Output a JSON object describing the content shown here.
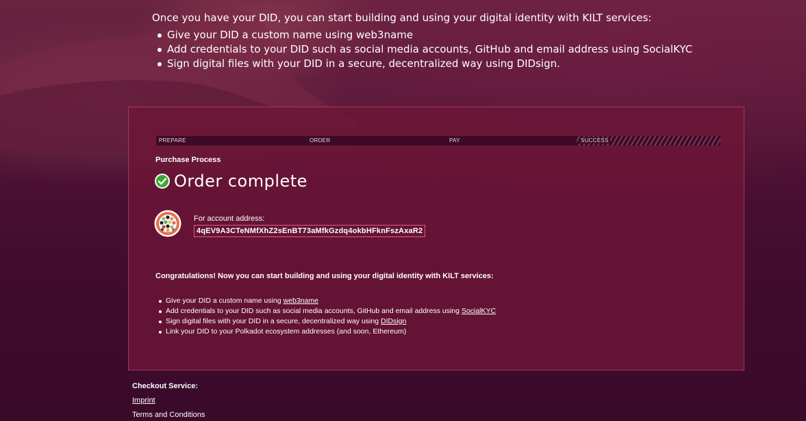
{
  "intro": {
    "heading": "Once you have your DID, you can start building and using your digital identity with KILT services:",
    "items": [
      "Give your DID a custom name using web3name",
      "Add credentials to your DID such as social media accounts, GitHub and email address using SocialKYC",
      "Sign digital files with your DID in a secure, decentralized way using DIDsign."
    ]
  },
  "steps": [
    {
      "label": "PREPARE"
    },
    {
      "label": "ORDER"
    },
    {
      "label": "PAY"
    },
    {
      "label": "SUCCESS"
    }
  ],
  "current_step": "SUCCESS",
  "purchase": {
    "title": "Purchase Process",
    "status": "Order complete",
    "account_label": "For account address:",
    "account_address": "4qEV9A3CTeNMfXhZ2sEnBT73aMfkGzdq4okbHFknFszAxaR2"
  },
  "congrats": {
    "heading": "Congratulations! Now you can start building and using your digital identity with KILT services:",
    "items": [
      {
        "text": "Give your DID a custom name using ",
        "link": "web3name",
        "after": ""
      },
      {
        "text": "Add credentials to your DID such as social media accounts, GitHub and email address using ",
        "link": "SocialKYC",
        "after": ""
      },
      {
        "text": "Sign digital files with your DID in a secure, decentralized way using ",
        "link": "DIDsign",
        "after": ""
      },
      {
        "text": "Link your DID to your Polkadot ecosystem addresses (and soon, Ethereum)",
        "link": "",
        "after": ""
      }
    ]
  },
  "footer": {
    "title": "Checkout Service:",
    "imprint": "Imprint",
    "terms": "Terms and Conditions"
  },
  "colors": {
    "background": "#4a0f2c",
    "card": "#6e1637",
    "card_border": "#d25a82",
    "progress_bg": "#3e0a25",
    "address_border": "#e25b8c",
    "check_green": "#3fa535"
  },
  "icons": {
    "status": "check-circle-icon",
    "account": "identicon-avatar"
  }
}
